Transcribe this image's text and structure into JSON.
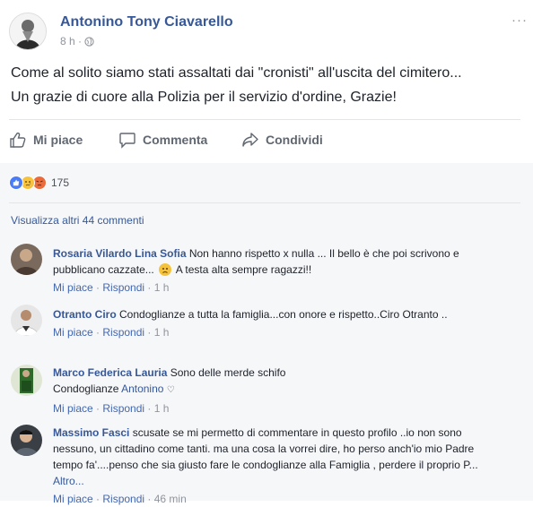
{
  "post": {
    "author": "Antonino Tony Ciavarello",
    "time": "8 h",
    "meta_sep": " · ",
    "text_lines": [
      "Come al solito siamo stati assaltati dai \"cronisti\" all'uscita del cimitero...",
      "Un grazie di cuore alla Polizia per il servizio d'ordine, Grazie!"
    ],
    "more_icon": "···"
  },
  "actions": {
    "like": "Mi piace",
    "comment": "Commenta",
    "share": "Condividi"
  },
  "reactions": {
    "count": "175",
    "types": [
      "like",
      "sad",
      "angry"
    ]
  },
  "view_more": "Visualizza altri 44 commenti",
  "comments": [
    {
      "author": "Rosaria Vilardo Lina Sofia",
      "text_a": " Non hanno rispetto x nulla ... Il bello è che poi scrivono e pubblicano cazzate... ",
      "text_b": " A testa alta sempre ragazzi!!",
      "like": "Mi piace",
      "reply": "Rispondi",
      "time": "1 h"
    },
    {
      "author": "Otranto Ciro",
      "text": " Condoglianze a tutta la famiglia...con onore e rispetto..Ciro Otranto ..",
      "like": "Mi piace",
      "reply": "Rispondi",
      "time": "1 h"
    },
    {
      "author": "Marco Federica Lauria",
      "text_a": " Sono delle merde schifo",
      "text_b": "Condoglianze ",
      "mention": "Antonino",
      "heart": "♡",
      "like": "Mi piace",
      "reply": "Rispondi",
      "time": "1 h"
    },
    {
      "author": "Massimo Fasci",
      "text": " scusate se mi permetto di commentare in questo profilo ..io non sono nessuno, un cittadino come tanti. ma una cosa la vorrei dire, ho perso anch'io mio Padre tempo fa'....penso che sia giusto fare le condoglianze alla Famiglia , perdere il proprio P... ",
      "more": "Altro...",
      "like": "Mi piace",
      "reply": "Rispondi",
      "time": "46 min"
    }
  ],
  "colors": {
    "link": "#365899",
    "meta": "#90949c",
    "like_blue": "#4267b2",
    "comments_bg": "#f6f7f9"
  }
}
